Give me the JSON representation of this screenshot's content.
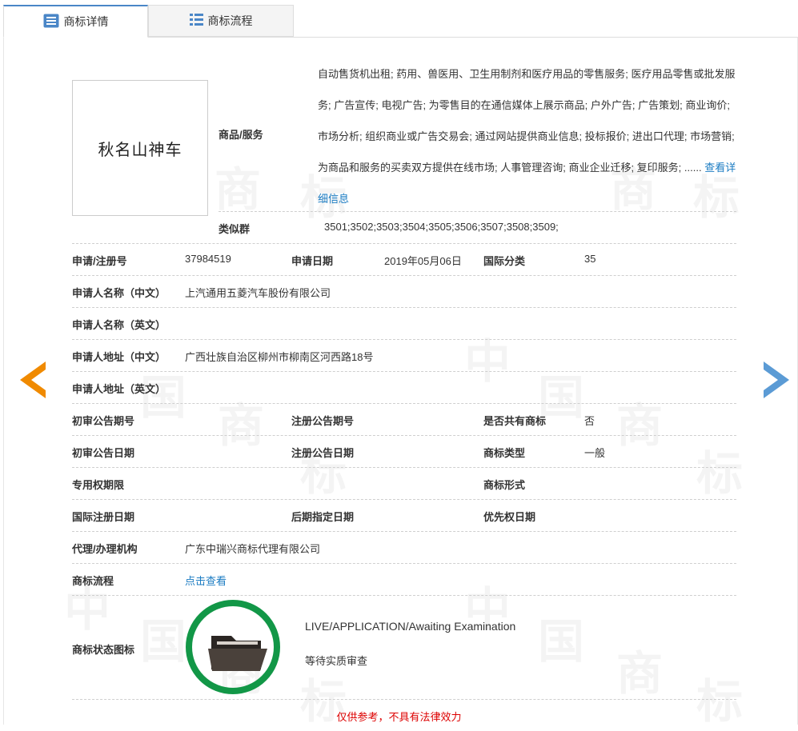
{
  "tabs": [
    {
      "label": "商标详情",
      "icon": "document-list-icon",
      "active": true
    },
    {
      "label": "商标流程",
      "icon": "grid-list-icon",
      "active": false
    }
  ],
  "trademark": {
    "logo_text": "秋名山神车"
  },
  "goods": {
    "label": "商品/服务",
    "text": "自动售货机出租; 药用、兽医用、卫生用制剂和医疗用品的零售服务; 医疗用品零售或批发服务; 广告宣传; 电视广告; 为零售目的在通信媒体上展示商品; 户外广告; 广告策划; 商业询价; 市场分析; 组织商业或广告交易会; 通过网站提供商业信息; 投标报价; 进出口代理; 市场营销; 为商品和服务的买卖双方提供在线市场; 人事管理咨询; 商业企业迁移; 复印服务; ...... ",
    "detail_link": "查看详细信息"
  },
  "similar": {
    "label": "类似群",
    "value": "3501;3502;3503;3504;3505;3506;3507;3508;3509;"
  },
  "fields": {
    "reg_no_label": "申请/注册号",
    "reg_no": "37984519",
    "apply_date_label": "申请日期",
    "apply_date": "2019年05月06日",
    "intl_class_label": "国际分类",
    "intl_class": "35",
    "applicant_cn_label": "申请人名称（中文）",
    "applicant_cn": "上汽通用五菱汽车股份有限公司",
    "applicant_en_label": "申请人名称（英文）",
    "applicant_en": "",
    "address_cn_label": "申请人地址（中文）",
    "address_cn": "广西壮族自治区柳州市柳南区河西路18号",
    "address_en_label": "申请人地址（英文）",
    "address_en": "",
    "prelim_no_label": "初审公告期号",
    "prelim_no": "",
    "reg_pub_no_label": "注册公告期号",
    "reg_pub_no": "",
    "shared_label": "是否共有商标",
    "shared": "否",
    "prelim_date_label": "初审公告日期",
    "prelim_date": "",
    "reg_pub_date_label": "注册公告日期",
    "reg_pub_date": "",
    "tm_type_label": "商标类型",
    "tm_type": "一般",
    "exclusive_label": "专用权期限",
    "exclusive": "",
    "tm_form_label": "商标形式",
    "tm_form": "",
    "intl_reg_date_label": "国际注册日期",
    "intl_reg_date": "",
    "later_date_label": "后期指定日期",
    "later_date": "",
    "priority_date_label": "优先权日期",
    "priority_date": "",
    "agent_label": "代理/办理机构",
    "agent": "广东中瑞兴商标代理有限公司",
    "flow_label": "商标流程",
    "flow_link": "点击查看",
    "status_label": "商标状态图标"
  },
  "status": {
    "en": "LIVE/APPLICATION/Awaiting Examination",
    "cn": "等待实质审查",
    "icon": "folder-icon",
    "ring_color": "#129747"
  },
  "nav": {
    "prev_icon": "left-arrow-icon",
    "next_icon": "right-arrow-icon",
    "prev_color": "#f08a00",
    "next_color": "#5b9bd5"
  },
  "watermark": {
    "chars": [
      "中",
      "国",
      "商",
      "标"
    ]
  },
  "disclaimer": "仅供参考，不具有法律效力"
}
